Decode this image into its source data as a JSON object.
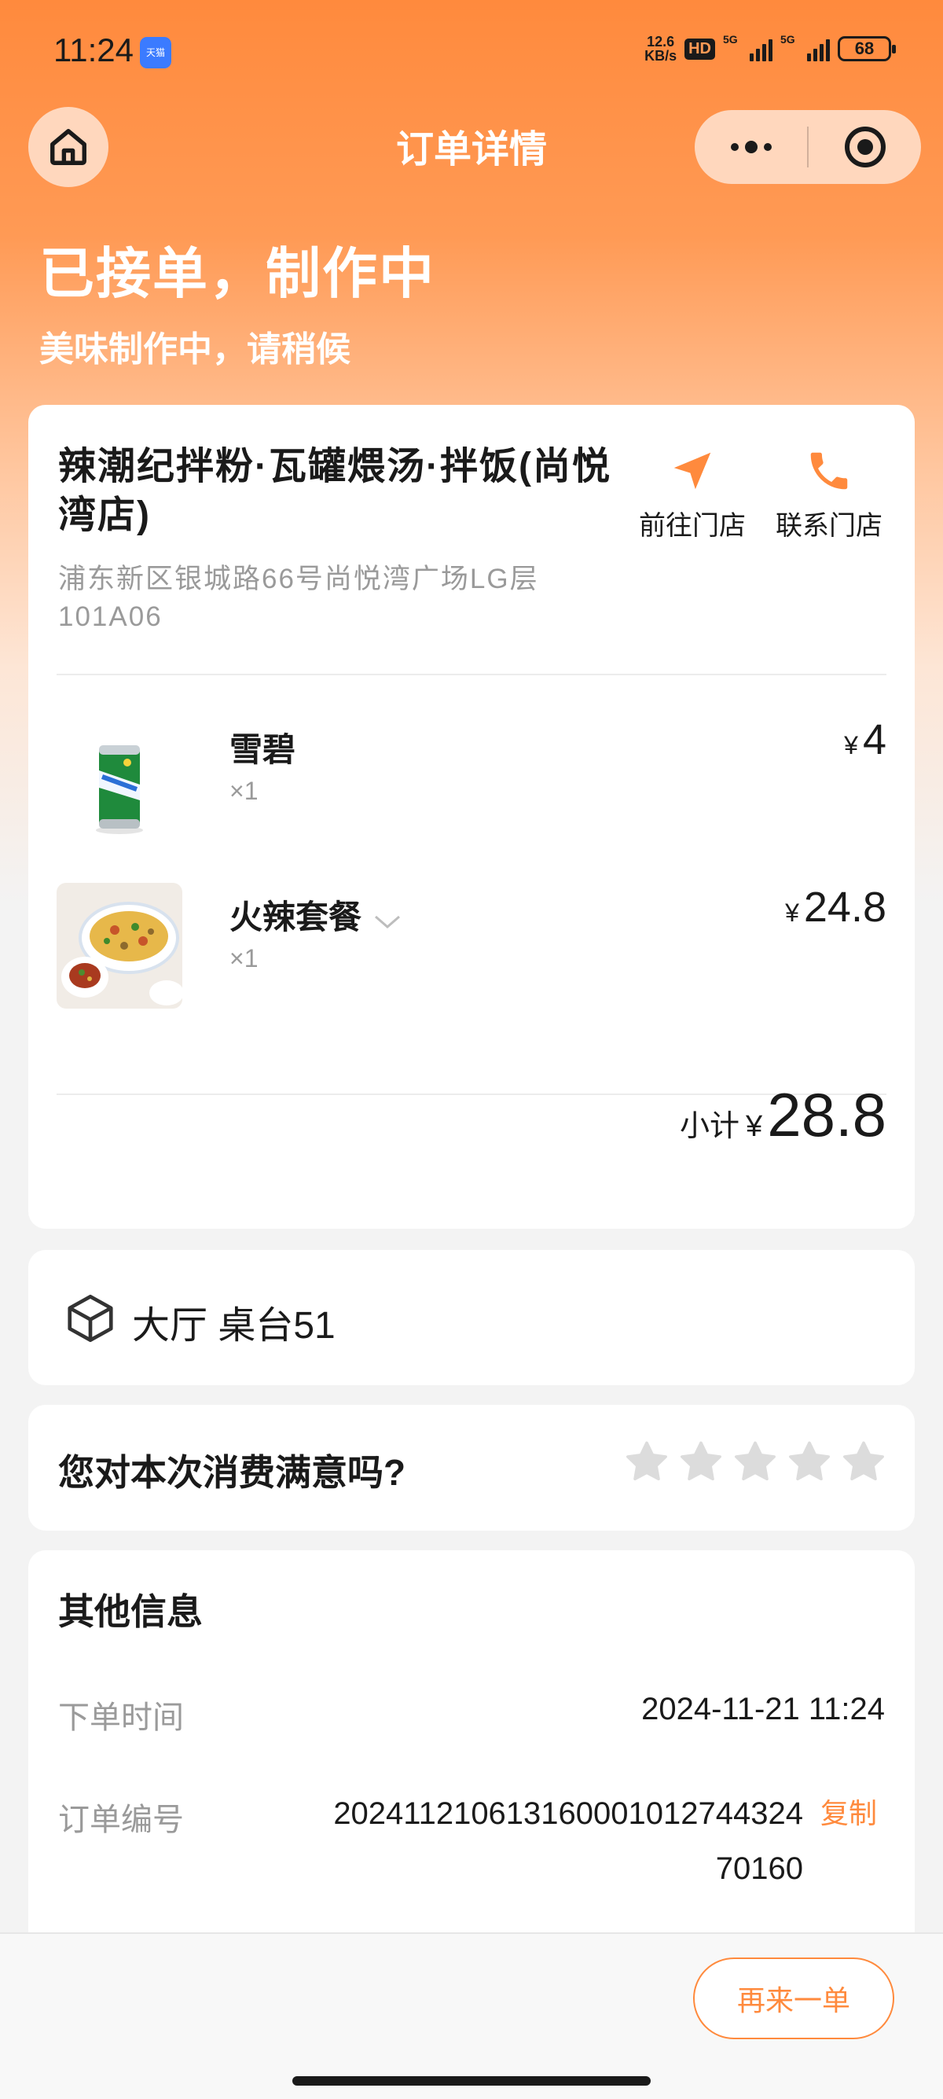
{
  "status_bar": {
    "time": "11:24",
    "app_icon": "天猫",
    "net_speed_value": "12.6",
    "net_speed_unit": "KB/s",
    "hd_badge": "HD",
    "signal1_label": "5G",
    "signal2_label": "5G",
    "battery": "68"
  },
  "nav": {
    "title": "订单详情"
  },
  "order": {
    "status": "已接单，制作中",
    "subtitle": "美味制作中，请稍候"
  },
  "store": {
    "name": "辣潮纪拌粉·瓦罐煨汤·拌饭(尚悦湾店)",
    "address": "浦东新区银城路66号尚悦湾广场LG层101A06",
    "goto_label": "前往门店",
    "contact_label": "联系门店"
  },
  "items": [
    {
      "name": "雪碧",
      "qty": "×1",
      "currency": "¥",
      "price": "4",
      "thumb_icon": "soda-can-icon"
    },
    {
      "name": "火辣套餐",
      "qty": "×1",
      "currency": "¥",
      "price": "24.8",
      "thumb_icon": "noodle-bowl-icon"
    }
  ],
  "subtotal": {
    "label": "小计",
    "currency": "¥",
    "value": "28.8"
  },
  "table": {
    "text": "大厅 桌台51"
  },
  "rating": {
    "question": "您对本次消费满意吗?",
    "stars_total": 5,
    "stars_selected": 0
  },
  "other_info": {
    "title": "其他信息",
    "order_time_label": "下单时间",
    "order_time": "2024-11-21 11:24",
    "order_no_label": "订单编号",
    "order_no": "20241121061316000101274432470160",
    "copy_label": "复制"
  },
  "bottom": {
    "reorder_label": "再来一单"
  },
  "colors": {
    "accent": "#ff8a3d",
    "header_gradient_top": "#ff8a3d",
    "star_empty": "#dcdcdc"
  }
}
